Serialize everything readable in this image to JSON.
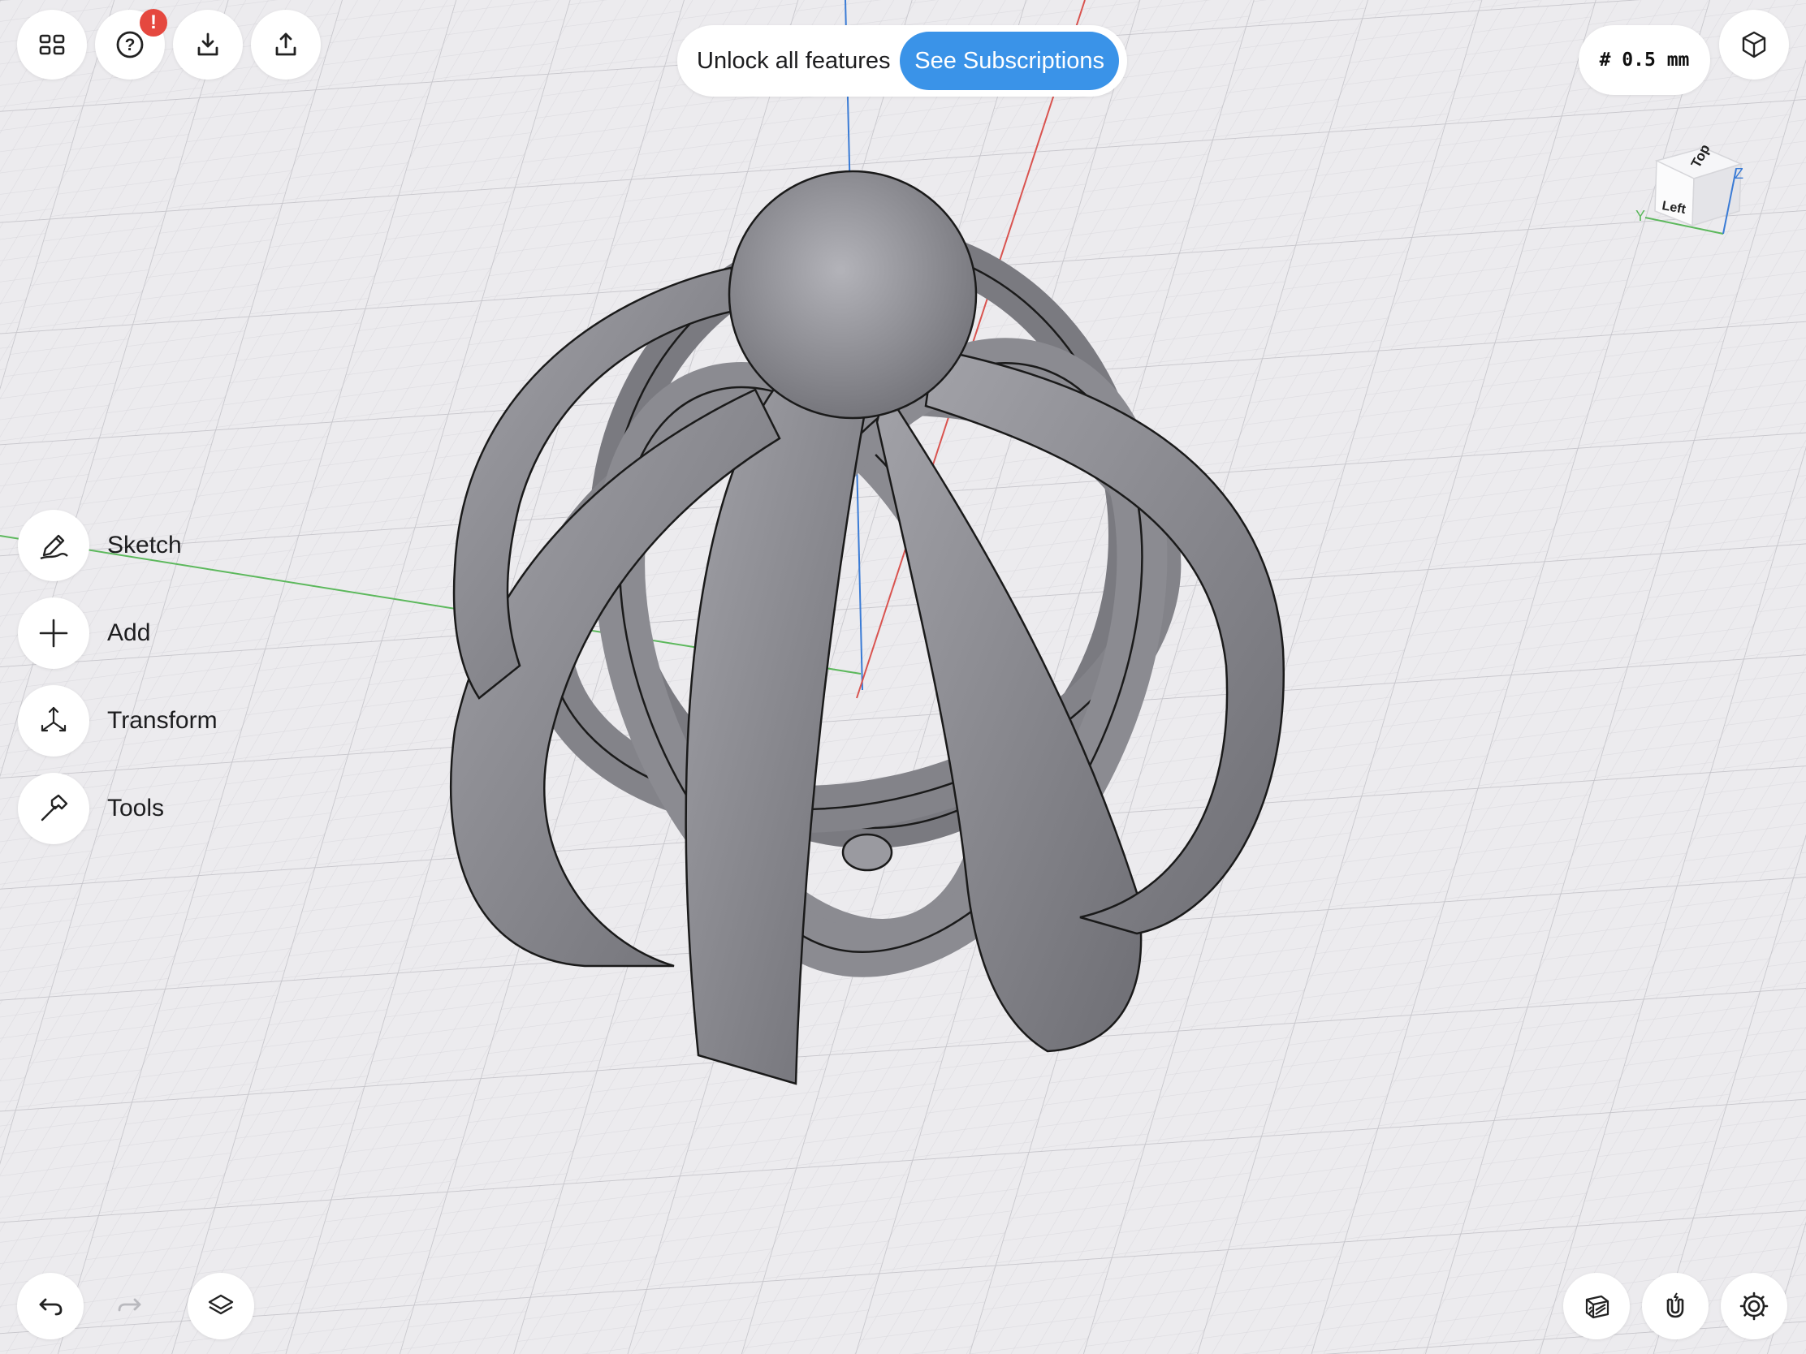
{
  "toolbar": {
    "apps_icon": "grid-icon",
    "help_icon": "help-icon",
    "help_badge": "!",
    "import_icon": "download-icon",
    "export_icon": "share-icon",
    "view_icon": "cube-view-icon"
  },
  "promo": {
    "text": "Unlock all features",
    "button": "See Subscriptions",
    "button_color": "#3a93e8"
  },
  "grid_size": "# 0.5 mm",
  "view_cube": {
    "top": "Top",
    "left": "Left",
    "axis_y": "Y",
    "axis_z": "Z"
  },
  "side_menu": {
    "items": [
      {
        "label": "Sketch",
        "icon": "pen-sketch-icon"
      },
      {
        "label": "Add",
        "icon": "plus-icon"
      },
      {
        "label": "Transform",
        "icon": "transform-arrows-icon"
      },
      {
        "label": "Tools",
        "icon": "hammer-icon"
      }
    ]
  },
  "bottom_bar": {
    "undo_icon": "undo-icon",
    "redo_icon": "redo-icon",
    "layers_icon": "layers-icon",
    "section_icon": "section-view-icon",
    "snap_icon": "magnet-icon",
    "settings_icon": "gear-icon"
  },
  "colors": {
    "background": "#ecebee",
    "axis_x": "#d9534f",
    "axis_y": "#5cb85c",
    "axis_z": "#3a7bd5",
    "model": "#8e8e94"
  }
}
